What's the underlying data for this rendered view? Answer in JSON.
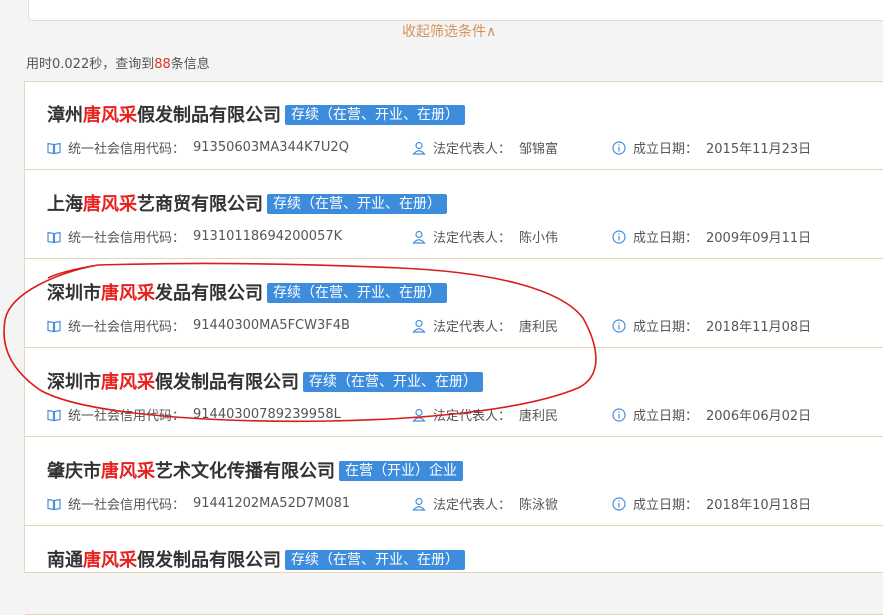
{
  "filter": {
    "collapse_label": "收起筛选条件∧"
  },
  "result_info": {
    "prefix": "用时0.022秒，查询到",
    "count": "88",
    "suffix": "条信息"
  },
  "labels": {
    "credit_code": "统一社会信用代码：",
    "legal_rep": "法定代表人：",
    "founded": "成立日期："
  },
  "results": [
    {
      "name_pre": "漳州",
      "highlight": "唐风采",
      "name_post": "假发制品有限公司",
      "status": "存续（在营、开业、在册）",
      "credit_code": "91350603MA344K7U2Q",
      "legal_rep": "邹锦富",
      "founded": "2015年11月23日"
    },
    {
      "name_pre": "上海",
      "highlight": "唐风采",
      "name_post": "艺商贸有限公司",
      "status": "存续（在营、开业、在册）",
      "credit_code": "91310118694200057K",
      "legal_rep": "陈小伟",
      "founded": "2009年09月11日"
    },
    {
      "name_pre": "深圳市",
      "highlight": "唐风采",
      "name_post": "发品有限公司",
      "status": "存续（在营、开业、在册）",
      "credit_code": "91440300MA5FCW3F4B",
      "legal_rep": "唐利民",
      "founded": "2018年11月08日"
    },
    {
      "name_pre": "深圳市",
      "highlight": "唐风采",
      "name_post": "假发制品有限公司",
      "status": "存续（在营、开业、在册）",
      "credit_code": "91440300789239958L",
      "legal_rep": "唐利民",
      "founded": "2006年06月02日"
    },
    {
      "name_pre": "肇庆市",
      "highlight": "唐风采",
      "name_post": "艺术文化传播有限公司",
      "status": "在营（开业）企业",
      "credit_code": "91441202MA52D7M081",
      "legal_rep": "陈泳锨",
      "founded": "2018年10月18日"
    },
    {
      "name_pre": "南通",
      "highlight": "唐风采",
      "name_post": "假发制品有限公司",
      "status": "存续（在营、开业、在册）",
      "credit_code": "",
      "legal_rep": "",
      "founded": ""
    }
  ]
}
